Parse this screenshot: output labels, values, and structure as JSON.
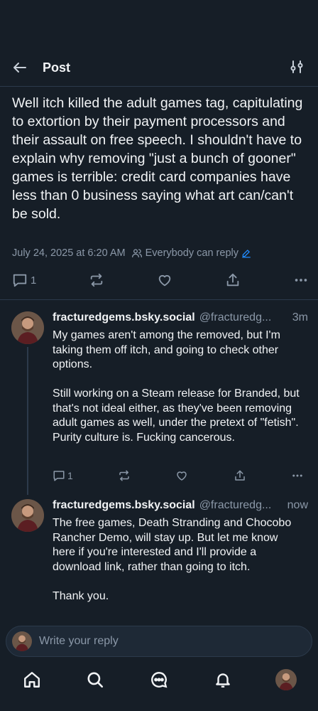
{
  "header": {
    "title": "Post"
  },
  "post": {
    "text": "Well itch killed the adult games tag, capitulating to extortion by their payment processors and their assault on free speech. I shouldn't have to explain why removing \"just a bunch of gooner\" games is terrible: credit card companies have less than 0 business saying what art can/can't be sold.",
    "timestamp": "July 24, 2025 at 6:20 AM",
    "audience": "Everybody can reply",
    "reply_count": "1"
  },
  "replies": [
    {
      "name": "fracturedgems.bsky.social",
      "handle": "@fracturedg...",
      "time": "3m",
      "text": "My games aren't among the removed, but I'm taking them off itch, and going to check other options.\n\nStill working on a Steam release for Branded, but that's not ideal either, as they've been removing adult games as well, under the pretext of \"fetish\". Purity culture is. Fucking cancerous.",
      "reply_count": "1"
    },
    {
      "name": "fracturedgems.bsky.social",
      "handle": "@fracturedg...",
      "time": "now",
      "text": "The free games, Death Stranding and Chocobo Rancher Demo, will stay up. But let me know here if you're interested and I'll provide a download link, rather than going to itch.\n\nThank you."
    }
  ],
  "composer": {
    "placeholder": "Write your reply"
  },
  "colors": {
    "background": "#161e27",
    "muted": "#8b98a8",
    "accent": "#208bfe"
  },
  "icons": [
    "back-arrow-icon",
    "settings-sliders-icon",
    "people-icon",
    "pencil-icon",
    "comment-icon",
    "repost-icon",
    "heart-icon",
    "share-icon",
    "more-icon",
    "home-icon",
    "search-icon",
    "chat-icon",
    "bell-icon"
  ]
}
